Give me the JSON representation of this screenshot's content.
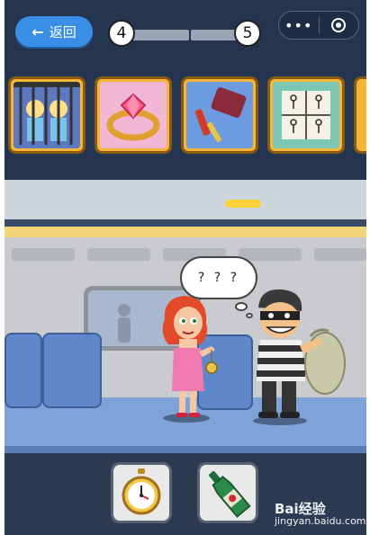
{
  "header": {
    "back_label": "返回",
    "level_current": "4",
    "level_next": "5",
    "menu_dots": "•••"
  },
  "level_cards": [
    {
      "name": "prison-level"
    },
    {
      "name": "ring-level"
    },
    {
      "name": "objects-level"
    },
    {
      "name": "diagram-level"
    }
  ],
  "scene": {
    "thought_text": "? ? ?"
  },
  "inventory": [
    {
      "name": "pocket-watch"
    },
    {
      "name": "wine-bottle"
    }
  ],
  "watermark": {
    "brand": "Bai经验",
    "url": "jingyan.baidu.com"
  },
  "colors": {
    "accent_blue": "#3b8ee6",
    "card_gold": "#f3b53a",
    "train_floor": "#7fa3d9",
    "dark_navy": "#253550"
  }
}
